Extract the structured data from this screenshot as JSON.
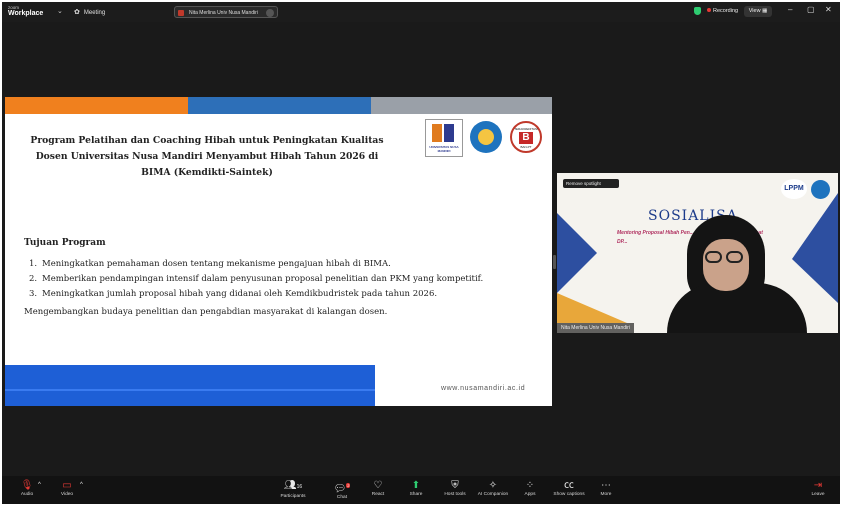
{
  "titlebar": {
    "app_name_top": "zoom",
    "app_name": "Workplace",
    "meeting_label": "Meeting",
    "tab_label": "Nita Merlina Univ Nusa Mandiri",
    "recording_label": "Recording",
    "view_label": "View",
    "colors": {
      "recording_dot": "#e53935",
      "shield": "#2ecc71"
    }
  },
  "slide": {
    "title": "Program Pelatihan dan Coaching Hibah untuk Peningkatan Kualitas Dosen Universitas Nusa Mandiri Menyambut Hibah Tahun 2026 di BIMA (Kemdikti-Saintek)",
    "logo_um_text": "UNIVERSITAS NUSA MANDIRI",
    "logo_b_top": "TERAKREDITASI",
    "logo_b_letter": "B",
    "logo_b_bottom": "BAN-PT",
    "objectives_heading": "Tujuan Program",
    "objectives": [
      {
        "num": "1.",
        "text": "Meningkatkan pemahaman dosen tentang mekanisme pengajuan hibah di BIMA."
      },
      {
        "num": "2.",
        "text": "Memberikan pendampingan intensif dalam penyusunan proposal penelitian dan PKM yang kompetitif."
      },
      {
        "num": "3.",
        "text": "Meningkatkan jumlah proposal hibah yang didanai oleh Kemdikbudristek pada tahun 2026."
      }
    ],
    "footer_text": "Mengembangkan budaya penelitian dan pengabdian masyarakat di kalangan dosen.",
    "url": "www.nusamandiri.ac.id",
    "band_colors": [
      "#f0801e",
      "#2d6fb8",
      "#9aa0a8"
    ],
    "blue_bar_color": "#1e5fd6"
  },
  "video": {
    "spotlight_label": "Remove spotlight",
    "background_title": "SOSIALISA",
    "background_subtitle": "Mentoring Proposal Hibah Pen... ...abdian kepada Masyarakat DP...",
    "lppm_logo": "LPPM",
    "participant_name": "Nita Merlina Univ Nusa Mandiri"
  },
  "toolbar": {
    "audio": "Audio",
    "video": "Video",
    "participants": "Participants",
    "participants_count": "16",
    "chat": "Chat",
    "chat_badge": "2",
    "react": "React",
    "share": "Share",
    "host_tools": "Host tools",
    "ai_companion": "AI Companion",
    "apps": "Apps",
    "show_captions": "Show captions",
    "more": "More",
    "leave": "Leave",
    "colors": {
      "muted": "#e53935",
      "share": "#2ecc71"
    }
  }
}
